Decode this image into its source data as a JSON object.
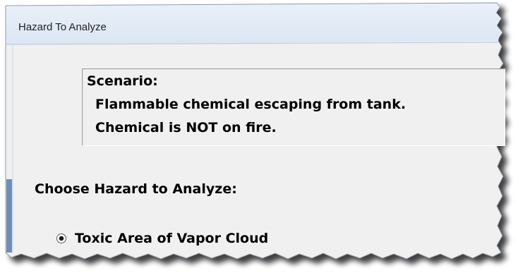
{
  "window": {
    "title": "Hazard To Analyze"
  },
  "scenario": {
    "heading": "Scenario:",
    "line1": "Flammable chemical escaping from tank.",
    "line2": "Chemical is NOT on fire."
  },
  "hazard": {
    "prompt": "Choose Hazard to Analyze:",
    "options": [
      {
        "label": "Toxic Area of Vapor Cloud",
        "selected": true
      }
    ]
  },
  "colors": {
    "window_bg": "#f0f0f0",
    "titlebar_bg": "#dfe9f5",
    "border": "#8e9ba9",
    "left_accent": "#6b8fb8"
  }
}
